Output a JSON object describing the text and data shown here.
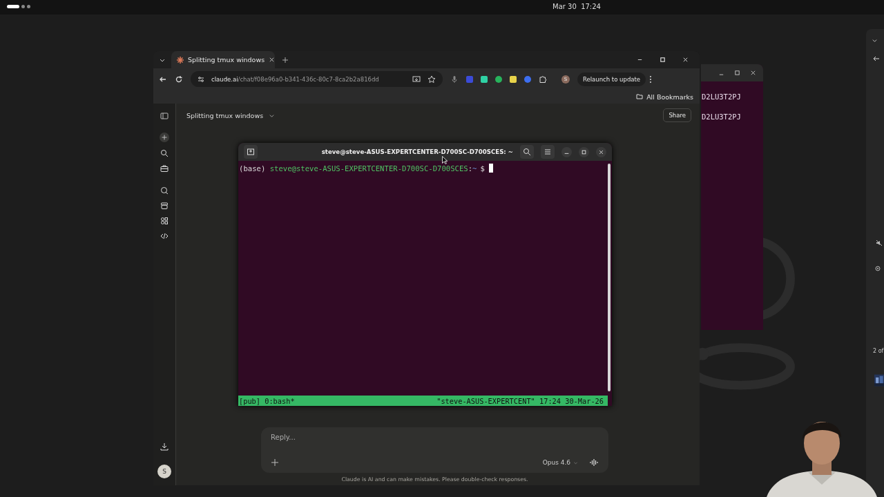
{
  "top_bar": {
    "workspaces": [
      {
        "selected": true
      },
      {
        "selected": false
      },
      {
        "selected": false
      }
    ],
    "clock": "Mar 30  17:24"
  },
  "back_terminal": {
    "lines": [
      "D2LU3T2PJ",
      "D2LU3T2PJ"
    ]
  },
  "browser": {
    "tabs": [
      {
        "title": "Splitting tmux windows",
        "selected": true
      }
    ],
    "url_host": "claude.ai",
    "url_path": "/chat/f08e96a0-b341-436c-80c7-8ca2b2a816dd",
    "profile_initial": "S",
    "relaunch": "Relaunch to update",
    "bookmarks": "All Bookmarks"
  },
  "chat": {
    "title": "Splitting tmux windows",
    "share": "Share",
    "avatar": "S",
    "reply_placeholder": "Reply...",
    "model": "Opus 4.6",
    "disclaimer": "Claude is AI and can make mistakes. Please double-check responses."
  },
  "terminal": {
    "title": "steve@steve-ASUS-EXPERTCENTER-D700SC-D700SCES: ~",
    "prompt_env": "(base)",
    "prompt_user": "steve@steve-ASUS-EXPERTCENTER-D700SC-D700SCES",
    "prompt_sep": ":",
    "prompt_path": "~",
    "prompt_symbol": "$",
    "status_left": "[pub] 0:bash*",
    "status_right": "\"steve-ASUS-EXPERTCENT\" 17:24 30-Mar-26"
  },
  "side_panel": {
    "counter": "2 of"
  }
}
